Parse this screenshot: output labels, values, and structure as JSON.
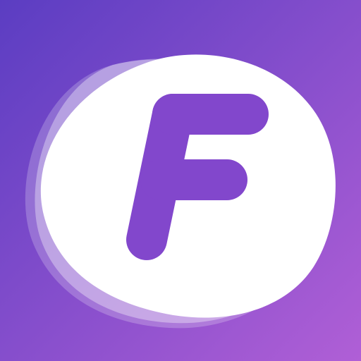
{
  "icon": {
    "semantic": "app-logo-icon",
    "letter": "F",
    "colors": {
      "gradient_start": "#5B3DC2",
      "gradient_end": "#B05FD6",
      "blob": "#FFFFFF",
      "letter": "#8247CC"
    }
  }
}
